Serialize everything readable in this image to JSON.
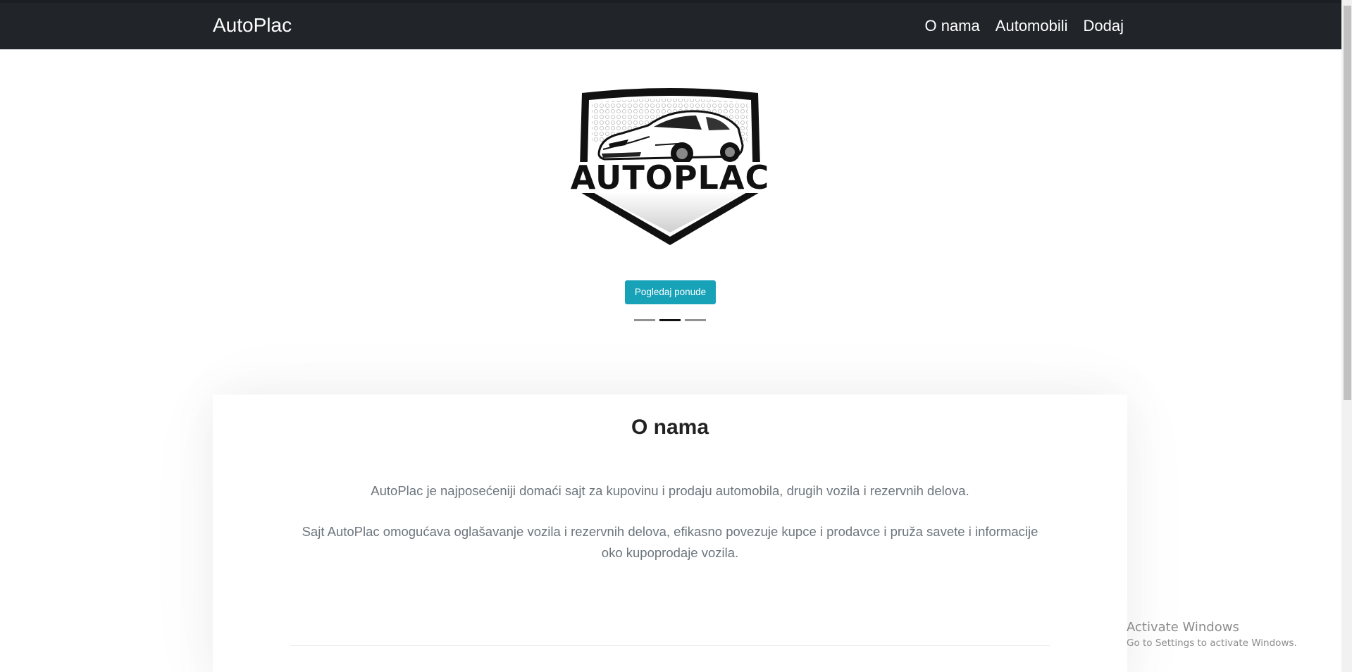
{
  "navbar": {
    "brand": "AutoPlac",
    "links": [
      "O nama",
      "Automobili",
      "Dodaj"
    ]
  },
  "hero": {
    "logo_text": "AUTOPLAC",
    "button_label": "Pogledaj ponude",
    "indicators": 3,
    "active_indicator": 2
  },
  "about": {
    "title": "O nama",
    "paragraphs": [
      "AutoPlac je najposećeniji domaći sajt za kupovinu i prodaju automobila, drugih vozila i rezervnih delova.",
      "Sajt AutoPlac omogućava oglašavanje vozila i rezervnih delova, efikasno povezuje kupce i prodavce i pruža savete i informacije oko kupoprodaje vozila."
    ]
  },
  "watermark": {
    "title": "Activate Windows",
    "subtitle": "Go to Settings to activate Windows."
  },
  "colors": {
    "navbar_bg": "#212529",
    "button_bg": "#17a2b8",
    "text_muted": "#6c757d"
  }
}
